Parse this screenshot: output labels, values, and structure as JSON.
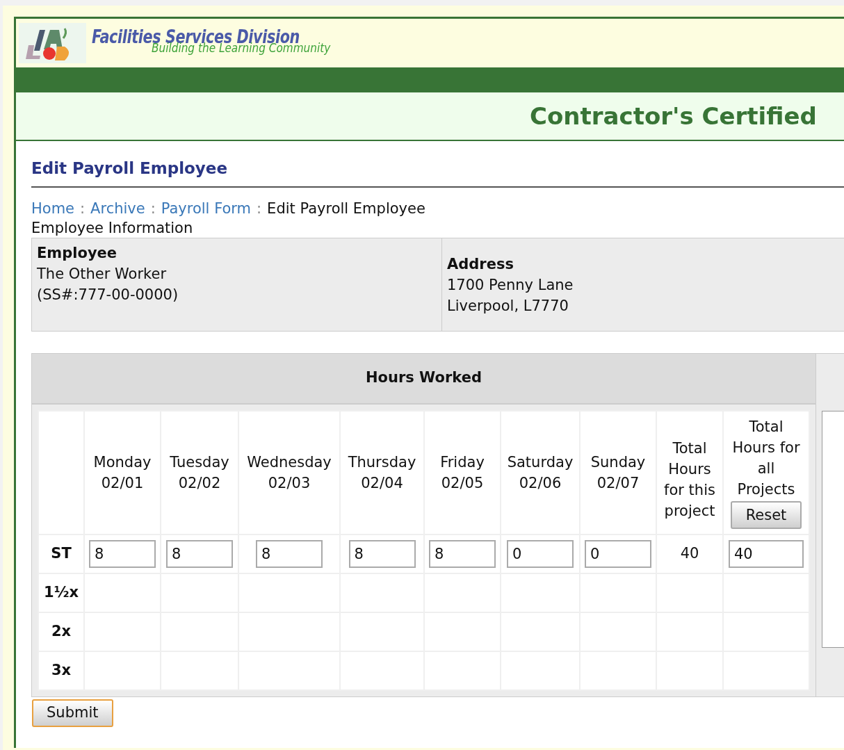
{
  "header": {
    "title": "Facilities Services Division",
    "tagline": "Building the Learning Community",
    "banner": "Contractor's Certified"
  },
  "page_title": "Edit Payroll Employee",
  "breadcrumb_separator": ":",
  "breadcrumb": [
    {
      "label": "Home",
      "kind": "link"
    },
    {
      "label": "Archive",
      "kind": "link"
    },
    {
      "label": "Payroll Form",
      "kind": "link"
    },
    {
      "label": "Edit Payroll Employee",
      "kind": "current"
    }
  ],
  "section_label": "Employee Information",
  "employee": {
    "label": "Employee",
    "name": "The Other Worker",
    "ssn": "(SS#:777-00-0000)"
  },
  "address": {
    "label": "Address",
    "line1": "1700 Penny Lane",
    "line2": "Liverpool, L7770"
  },
  "hours": {
    "title": "Hours Worked",
    "days": [
      {
        "day": "Monday",
        "date": "02/01"
      },
      {
        "day": "Tuesday",
        "date": "02/02"
      },
      {
        "day": "Wednesday",
        "date": "02/03"
      },
      {
        "day": "Thursday",
        "date": "02/04"
      },
      {
        "day": "Friday",
        "date": "02/05"
      },
      {
        "day": "Saturday",
        "date": "02/06"
      },
      {
        "day": "Sunday",
        "date": "02/07"
      }
    ],
    "total_project_header": "Total Hours for this project",
    "total_all_header": "Total Hours for all Projects",
    "reset_button": "Reset",
    "rows": [
      {
        "label": "ST",
        "values": [
          "8",
          "8",
          "8",
          "8",
          "8",
          "0",
          "0"
        ],
        "total_project": "40",
        "total_all": "40"
      },
      {
        "label": "1½x"
      },
      {
        "label": "2x"
      },
      {
        "label": "3x"
      }
    ]
  },
  "submit_button": "Submit"
}
